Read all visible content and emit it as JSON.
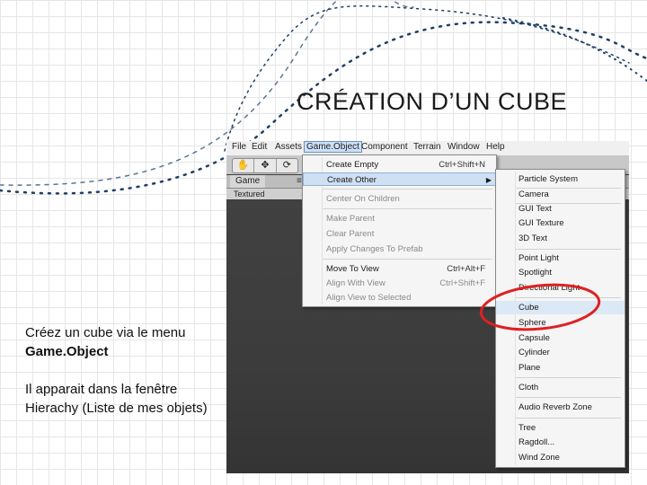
{
  "slide": {
    "title": "CRÉATION D’UN CUBE",
    "instruction_1": "Créez un cube via le menu",
    "instruction_1_bold": "Game.Object",
    "instruction_2": "Il apparait dans la fenêtre Hierachy (Liste de mes objets)"
  },
  "menubar": [
    "File",
    "Edit",
    "Assets",
    "Game.Object",
    "Component",
    "Terrain",
    "Window",
    "Help"
  ],
  "toolbar": {
    "buttons": [
      "✋",
      "✥",
      "⟳"
    ]
  },
  "game_tab": {
    "label": "Game",
    "pin": "≡",
    "mode": "Textured"
  },
  "gameobject_menu": {
    "items": [
      {
        "label": "Create Empty",
        "shortcut": "Ctrl+Shift+N"
      },
      {
        "label": "Create Other",
        "shortcut": "▶"
      },
      {
        "label": "Center On Children",
        "shortcut": ""
      },
      {
        "label": "Make Parent",
        "shortcut": ""
      },
      {
        "label": "Clear Parent",
        "shortcut": ""
      },
      {
        "label": "Apply Changes To Prefab",
        "shortcut": ""
      },
      {
        "label": "Move To View",
        "shortcut": "Ctrl+Alt+F"
      },
      {
        "label": "Align With View",
        "shortcut": "Ctrl+Shift+F"
      },
      {
        "label": "Align View to Selected",
        "shortcut": ""
      }
    ]
  },
  "create_other_menu": {
    "items": [
      "Particle System",
      "Camera",
      "GUI Text",
      "GUI Texture",
      "3D Text",
      "Point Light",
      "Spotlight",
      "Directional Light",
      "Cube",
      "Sphere",
      "Capsule",
      "Cylinder",
      "Plane",
      "Cloth",
      "Audio Reverb Zone",
      "Tree",
      "Ragdoll...",
      "Wind Zone"
    ]
  },
  "colors": {
    "highlight_ellipse": "#e02020",
    "deco_dots": "#1f3f66"
  }
}
